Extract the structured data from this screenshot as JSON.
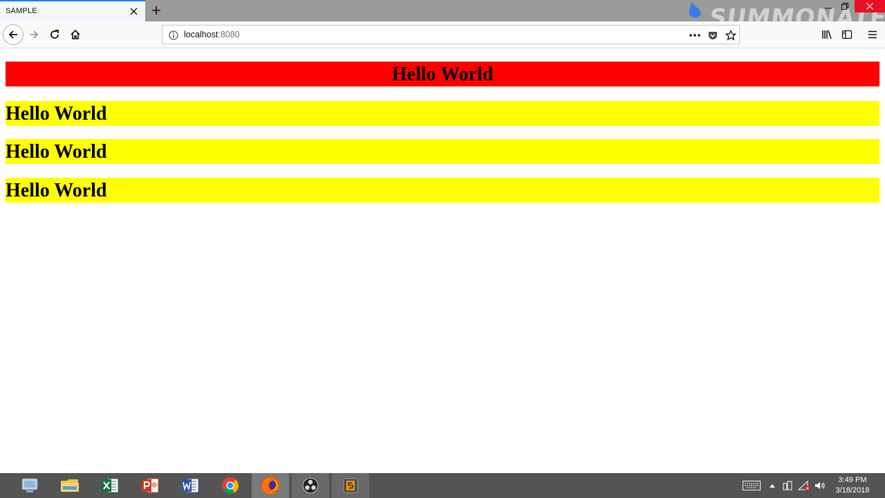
{
  "browser": {
    "tab": {
      "title": "SAMPLE"
    },
    "watermark": "SUMMONATE",
    "url": {
      "host": "localhost",
      "port": ":8080"
    }
  },
  "page": {
    "banner": "Hello World",
    "rows": [
      "Hello World",
      "Hello World",
      "Hello World"
    ]
  },
  "taskbar": {
    "apps": [
      "file-explorer-old",
      "file-explorer",
      "excel",
      "powerpoint",
      "word",
      "chrome",
      "firefox",
      "obs",
      "sublime-text"
    ],
    "clock": {
      "time": "3:49 PM",
      "date": "3/18/2018"
    }
  },
  "colors": {
    "banner": "#ff0000",
    "rows": "#ffff00",
    "accent": "#0a84ff"
  }
}
